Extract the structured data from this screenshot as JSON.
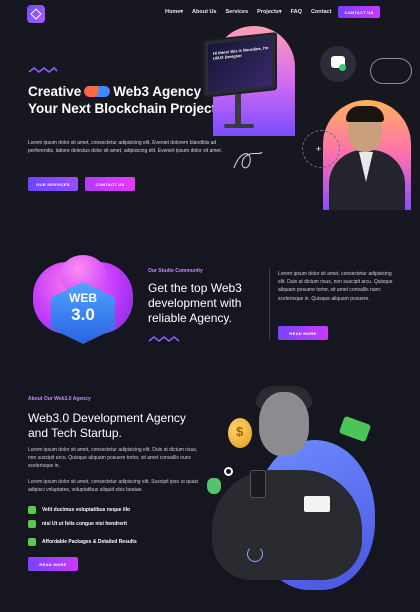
{
  "nav": {
    "links": [
      "Home",
      "About Us",
      "Services",
      "Projects",
      "FAQ",
      "Contact"
    ],
    "home_caret": "▾",
    "projects_caret": "▾",
    "contact_button": "CONTACT US"
  },
  "hero": {
    "title_part1": "Creative",
    "title_part2": "Web3 Agency to Your Next Blockchain Project",
    "description": "Lorem ipsum dolor sit amet, consectetur adipisicing elit. Eveniet dolorem blanditiis ad perferendis, labore delectus dolor sit amet, adipisicing elit. Eveniet ipsum dolor sit amet.",
    "btn_services": "OUR SERVICES",
    "btn_contact": "CONTACT US",
    "monitor_text": "Hi there! this is Nourdine, I'm UI/UX Designer"
  },
  "community": {
    "badge_top": "WEB",
    "badge_bottom": "3.0",
    "label": "Our Studio Community",
    "title": "Get the top Web3 development with reliable Agency.",
    "description": "Lorem ipsum dolor sit amet, consectetur adipisicing elit. Duis at dictum risus, non suscipit arcu. Quisque aliquam posuere tortor, sit amet convallis nunc scelerisque in. Quisque aliquam posuere.",
    "button": "READ MORE"
  },
  "about": {
    "label": "About Our Web3.0 Agency",
    "title": "Web3.0 Development Agency and Tech Startup.",
    "description1": "Lorem ipsum dolor sit amet, consectetur adipisicing elit. Duis at dictum risus, non suscipit arcu. Quisque aliquam posuere tortor, sit amet convallis nunc scelerisque in.",
    "description2": "Lorem ipsum dolor sit amet, consectetur adipiscing elit. Suscipit ipso ut quasi adipisci voluptates, voluptatibus aliquid obis beatae.",
    "features": [
      "Velit ducimus voluptatibus neque illo",
      "nisi Ut ut felis congue nisi hendrerit",
      "Affordable Packages & Detailed Results"
    ],
    "button": "READ MORE",
    "coin_symbol": "$"
  },
  "colors": {
    "background": "#15161f",
    "accent_purple": "#7c42ff",
    "accent_magenta": "#c83bff",
    "label_purple": "#c08bff",
    "check_green": "#59c94d"
  }
}
